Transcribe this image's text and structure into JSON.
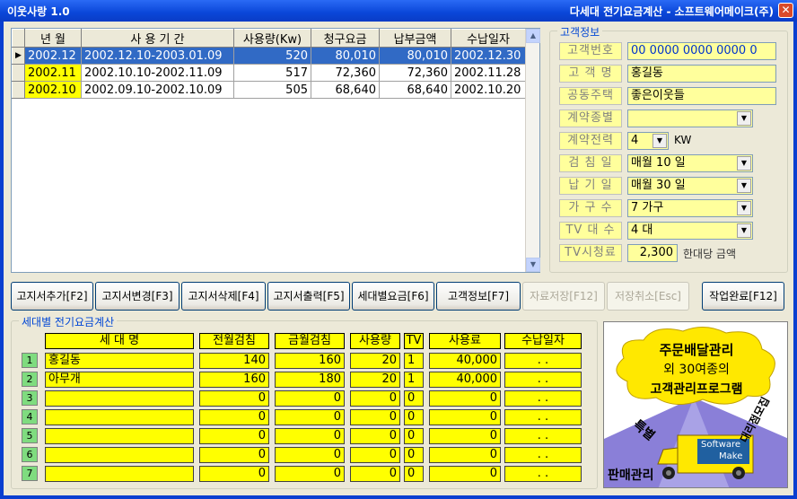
{
  "window": {
    "title_left": "이웃사랑 1.0",
    "title_right": "다세대 전기요금계산 - 소프트웨어메이크(주)",
    "close_glyph": "✕"
  },
  "grid": {
    "headers": [
      "년 월",
      "사 용 기 간",
      "사용량(Kw)",
      "청구요금",
      "납부금액",
      "수납일자"
    ],
    "rows": [
      {
        "ym": "2002.12",
        "period": "2002.12.10-2003.01.09",
        "usage": "520",
        "billed": "80,010",
        "paid": "80,010",
        "date": "2002.12.30"
      },
      {
        "ym": "2002.11",
        "period": "2002.10.10-2002.11.09",
        "usage": "517",
        "billed": "72,360",
        "paid": "72,360",
        "date": "2002.11.28"
      },
      {
        "ym": "2002.10",
        "period": "2002.09.10-2002.10.09",
        "usage": "505",
        "billed": "68,640",
        "paid": "68,640",
        "date": "2002.10.20"
      }
    ],
    "current_row_glyph": "▶"
  },
  "info": {
    "legend": "고객정보",
    "customer_no_label": "고객번호",
    "customer_no": "00 0000 0000 0000 0",
    "name_label": "고 객 명",
    "name": "홍길동",
    "complex_label": "공동주택",
    "complex": "좋은이웃들",
    "contract_type_label": "계약종별",
    "contract_type": "",
    "contract_power_label": "계약전력",
    "contract_power": "4",
    "contract_power_unit": "KW",
    "meter_day_label": "검 침 일",
    "meter_day": "매월 10 일",
    "due_day_label": "납 기 일",
    "due_day": "매월 30 일",
    "households_label": "가 구 수",
    "households": "7 가구",
    "tv_count_label": "TV 대 수",
    "tv_count": "4 대",
    "tv_fee_label": "TV시청료",
    "tv_fee": "2,300",
    "tv_fee_note": "한대당 금액"
  },
  "buttons": {
    "add": "고지서추가[F2]",
    "edit": "고지서변경[F3]",
    "delete": "고지서삭제[F4]",
    "print": "고지서출력[F5]",
    "household_fee": "세대별요금[F6]",
    "customer_info": "고객정보[F7]",
    "save": "자료저장[F12]",
    "cancel": "저장취소[Esc]",
    "finish": "작업완료[F12]"
  },
  "household": {
    "legend": "세대별 전기요금계산",
    "headers": [
      "세 대 명",
      "전월검침",
      "금월검침",
      "사용량",
      "TV",
      "사용료",
      "수납일자"
    ],
    "rows": [
      {
        "idx": "1",
        "name": "홍길동",
        "prev": "140",
        "curr": "160",
        "usage": "20",
        "tv": "1",
        "fee": "40,000",
        "date": ".  ."
      },
      {
        "idx": "2",
        "name": "아무개",
        "prev": "160",
        "curr": "180",
        "usage": "20",
        "tv": "1",
        "fee": "40,000",
        "date": ".  ."
      },
      {
        "idx": "3",
        "name": "",
        "prev": "0",
        "curr": "0",
        "usage": "0",
        "tv": "0",
        "fee": "0",
        "date": ".  ."
      },
      {
        "idx": "4",
        "name": "",
        "prev": "0",
        "curr": "0",
        "usage": "0",
        "tv": "0",
        "fee": "0",
        "date": ".  ."
      },
      {
        "idx": "5",
        "name": "",
        "prev": "0",
        "curr": "0",
        "usage": "0",
        "tv": "0",
        "fee": "0",
        "date": ".  ."
      },
      {
        "idx": "6",
        "name": "",
        "prev": "0",
        "curr": "0",
        "usage": "0",
        "tv": "0",
        "fee": "0",
        "date": ".  ."
      },
      {
        "idx": "7",
        "name": "",
        "prev": "0",
        "curr": "0",
        "usage": "0",
        "tv": "0",
        "fee": "0",
        "date": ".  ."
      }
    ]
  },
  "ad": {
    "line1": "주문배달관리",
    "line2": "외 30여종의",
    "line3": "고객관리프로그램",
    "tag_left": "특별",
    "tag_right": "대리점모집",
    "truck_label1": "Software",
    "truck_label2": "Make",
    "bottom": "판매관리"
  },
  "colors": {
    "titlebar": "#0a46d8",
    "field_yellow": "#ffff9c",
    "cell_yellow": "#ffff00",
    "selection": "#316ac5",
    "index_green": "#7fdc7f"
  }
}
